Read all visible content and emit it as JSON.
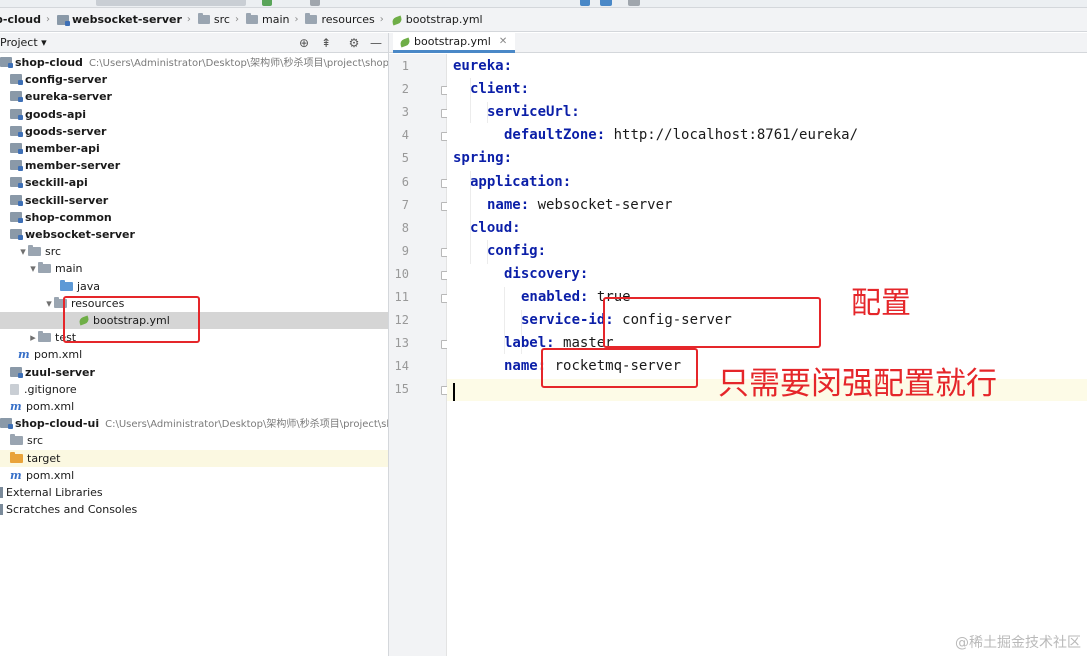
{
  "breadcrumb": [
    {
      "label": "p-cloud",
      "icon": "folder-icon",
      "bold": true
    },
    {
      "label": "websocket-server",
      "icon": "module-icon",
      "bold": true
    },
    {
      "label": "src",
      "icon": "folder-icon",
      "bold": false
    },
    {
      "label": "main",
      "icon": "folder-icon",
      "bold": false
    },
    {
      "label": "resources",
      "icon": "folder-icon",
      "bold": false
    },
    {
      "label": "bootstrap.yml",
      "icon": "yml-icon",
      "bold": false
    }
  ],
  "project_panel": {
    "title": "Project ▾",
    "icons": [
      "target-icon",
      "collapse-icon",
      "gear-icon",
      "minimize-icon"
    ]
  },
  "tree": [
    {
      "label": "shop-cloud",
      "path": "C:\\Users\\Administrator\\Desktop\\架构师\\秒杀项目\\project\\shop-c",
      "bold": true,
      "level": 0,
      "arrow": "",
      "icon": "module"
    },
    {
      "label": "config-server",
      "bold": true,
      "level": 1,
      "arrow": "",
      "icon": "module"
    },
    {
      "label": "eureka-server",
      "bold": true,
      "level": 1,
      "arrow": "",
      "icon": "module"
    },
    {
      "label": "goods-api",
      "bold": true,
      "level": 1,
      "arrow": "",
      "icon": "module"
    },
    {
      "label": "goods-server",
      "bold": true,
      "level": 1,
      "arrow": "",
      "icon": "module"
    },
    {
      "label": "member-api",
      "bold": true,
      "level": 1,
      "arrow": "",
      "icon": "module"
    },
    {
      "label": "member-server",
      "bold": true,
      "level": 1,
      "arrow": "",
      "icon": "module"
    },
    {
      "label": "seckill-api",
      "bold": true,
      "level": 1,
      "arrow": "",
      "icon": "module"
    },
    {
      "label": "seckill-server",
      "bold": true,
      "level": 1,
      "arrow": "",
      "icon": "module"
    },
    {
      "label": "shop-common",
      "bold": true,
      "level": 1,
      "arrow": "",
      "icon": "module"
    },
    {
      "label": "websocket-server",
      "bold": true,
      "level": 1,
      "arrow": "",
      "icon": "module"
    },
    {
      "label": "src",
      "bold": false,
      "level": 2,
      "arrow": "v",
      "icon": "folder"
    },
    {
      "label": "main",
      "bold": false,
      "level": 3,
      "arrow": "v",
      "icon": "folder"
    },
    {
      "label": "java",
      "bold": false,
      "level": 5,
      "arrow": "",
      "icon": "folder-blue"
    },
    {
      "label": "resources",
      "bold": false,
      "level": 4,
      "arrow": "v",
      "icon": "folder"
    },
    {
      "label": "bootstrap.yml",
      "bold": false,
      "level": 6,
      "arrow": "",
      "icon": "yml",
      "selected": true
    },
    {
      "label": "test",
      "bold": false,
      "level": 3,
      "arrow": ">",
      "icon": "folder"
    },
    {
      "label": "pom.xml",
      "bold": false,
      "level": 2,
      "arrow": "",
      "icon": "maven"
    },
    {
      "label": "zuul-server",
      "bold": true,
      "level": 1,
      "arrow": "",
      "icon": "module"
    },
    {
      "label": ".gitignore",
      "bold": false,
      "level": 1,
      "arrow": "",
      "icon": "file"
    },
    {
      "label": "pom.xml",
      "bold": false,
      "level": 1,
      "arrow": "",
      "icon": "maven"
    },
    {
      "label": "shop-cloud-ui",
      "path": "C:\\Users\\Administrator\\Desktop\\架构师\\秒杀项目\\project\\sho",
      "bold": true,
      "level": 0,
      "arrow": "",
      "icon": "module"
    },
    {
      "label": "src",
      "bold": false,
      "level": 1,
      "arrow": "",
      "icon": "folder"
    },
    {
      "label": "target",
      "bold": false,
      "level": 1,
      "arrow": "",
      "icon": "folder-orange",
      "highlight": true
    },
    {
      "label": "pom.xml",
      "bold": false,
      "level": 1,
      "arrow": "",
      "icon": "maven"
    },
    {
      "label": "External Libraries",
      "bold": false,
      "level": 0,
      "arrow": "",
      "icon": "lib"
    },
    {
      "label": "Scratches and Consoles",
      "bold": false,
      "level": 0,
      "arrow": "",
      "icon": "lib"
    }
  ],
  "editor": {
    "tab_label": "bootstrap.yml",
    "lines": [
      {
        "n": "1",
        "indent": 0,
        "key": "eureka",
        "value": ""
      },
      {
        "n": "2",
        "indent": 1,
        "key": "client",
        "value": ""
      },
      {
        "n": "3",
        "indent": 2,
        "key": "serviceUrl",
        "value": ""
      },
      {
        "n": "4",
        "indent": 3,
        "key": "defaultZone",
        "value": "http://localhost:8761/eureka/"
      },
      {
        "n": "5",
        "indent": 0,
        "key": "spring",
        "value": ""
      },
      {
        "n": "6",
        "indent": 1,
        "key": "application",
        "value": ""
      },
      {
        "n": "7",
        "indent": 2,
        "key": "name",
        "value": "websocket-server"
      },
      {
        "n": "8",
        "indent": 1,
        "key": "cloud",
        "value": ""
      },
      {
        "n": "9",
        "indent": 2,
        "key": "config",
        "value": ""
      },
      {
        "n": "10",
        "indent": 3,
        "key": "discovery",
        "value": ""
      },
      {
        "n": "11",
        "indent": 4,
        "key": "enabled",
        "value": "true"
      },
      {
        "n": "12",
        "indent": 4,
        "key": "service-id",
        "value": "config-server"
      },
      {
        "n": "13",
        "indent": 3,
        "key": "label",
        "value": "master"
      },
      {
        "n": "14",
        "indent": 3,
        "key": "name",
        "value": "rocketmq-server"
      },
      {
        "n": "15",
        "indent": 0,
        "key": "",
        "value": ""
      }
    ]
  },
  "annotations": {
    "config_label": "配置",
    "only_need_label": "只需要闵强配置就行"
  },
  "watermark": "@稀土掘金技术社区",
  "colors": {
    "annotation_red": "#e5262a",
    "yaml_key": "#0b1fa8",
    "selection": "#d5d5d5",
    "tab_underline": "#4a88c7"
  }
}
